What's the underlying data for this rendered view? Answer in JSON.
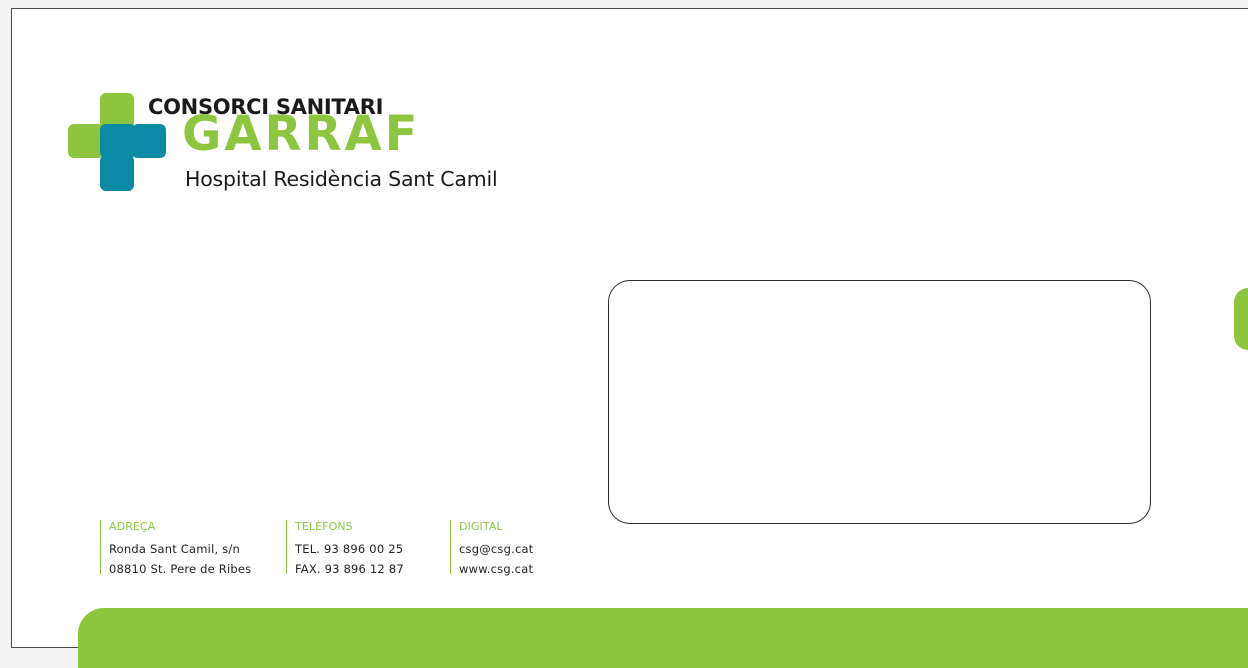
{
  "header": {
    "org_name": "CONSORCI SANITARI",
    "brand": "GARRAF",
    "subtitle": "Hospital Residència Sant Camil"
  },
  "contacts": [
    {
      "label": "ADREÇA",
      "lines": [
        "Ronda Sant Camil, s/n",
        "08810 St. Pere de Ribes"
      ]
    },
    {
      "label": "TELÈFONS",
      "lines": [
        "TEL. 93 896 00 25",
        "FAX. 93 896 12 87"
      ]
    },
    {
      "label": "DIGITAL",
      "lines": [
        "csg@csg.cat",
        "www.csg.cat"
      ]
    }
  ],
  "colors": {
    "brand_green": "#8cc63f",
    "brand_teal": "#0b8aa6",
    "text_dark": "#1a1a1a",
    "page": "#ffffff"
  },
  "icons": {
    "logo": "cross-logo-icon"
  }
}
